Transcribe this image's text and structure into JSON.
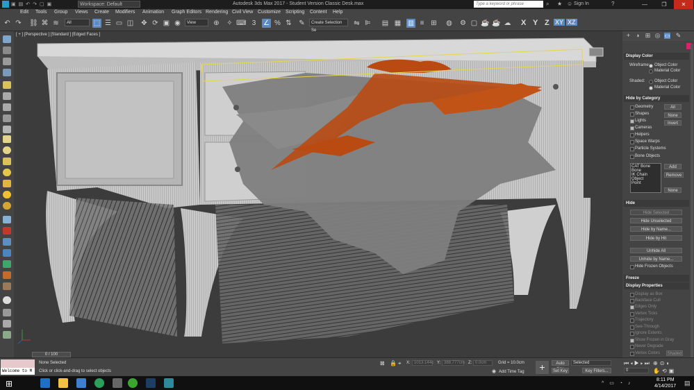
{
  "titlebar": {
    "workspace": "Workspace: Default",
    "title": "Autodesk 3ds Max 2017 - Student Version    Classic Desk.max",
    "search_placeholder": "Type a keyword or phrase",
    "sign_in": "Sign In"
  },
  "menu": [
    "Edit",
    "Tools",
    "Group",
    "Views",
    "Create",
    "Modifiers",
    "Animation",
    "Graph Editors",
    "Rendering",
    "Civil View",
    "Customize",
    "Scripting",
    "Content",
    "Help"
  ],
  "toolbar": {
    "filter_value": "All",
    "coord_value": "View",
    "selection_set_placeholder": "Create Selection Se",
    "axis_labels": [
      "X",
      "Y",
      "Z",
      "XY",
      "XZ"
    ]
  },
  "viewport": {
    "label": "[ + ] [Perspective ] [Standard ] [Edged Faces ]"
  },
  "panel": {
    "display_color": {
      "title": "Display Color",
      "wireframe_label": "Wireframe:",
      "shaded_label": "Shaded:",
      "object_color": "Object Color",
      "material_color": "Material Color"
    },
    "hide_by_category": {
      "title": "Hide by Category",
      "items": [
        {
          "label": "Geometry",
          "checked": false
        },
        {
          "label": "Shapes",
          "checked": false
        },
        {
          "label": "Lights",
          "checked": true
        },
        {
          "label": "Cameras",
          "checked": true
        },
        {
          "label": "Helpers",
          "checked": false
        },
        {
          "label": "Space Warps",
          "checked": false
        },
        {
          "label": "Particle Systems",
          "checked": false
        },
        {
          "label": "Bone Objects",
          "checked": false
        }
      ],
      "btn_all": "All",
      "btn_none": "None",
      "btn_invert": "Invert",
      "list": [
        "CAT Bone",
        "Bone",
        "IK Chain Object",
        "Point"
      ],
      "btn_add": "Add",
      "btn_remove": "Remove",
      "btn_none2": "None"
    },
    "hide": {
      "title": "Hide",
      "hide_selected": "Hide Selected",
      "hide_unselected": "Hide Unselected",
      "hide_by_name": "Hide by Name...",
      "hide_by_hit": "Hide by Hit",
      "unhide_all": "Unhide All",
      "unhide_by_name": "Unhide by Name...",
      "hide_frozen": "Hide Frozen Objects"
    },
    "freeze": {
      "title": "Freeze"
    },
    "display_properties": {
      "title": "Display Properties",
      "items": [
        {
          "label": "Display as Box",
          "checked": false
        },
        {
          "label": "Backface Cull",
          "checked": false
        },
        {
          "label": "Edges Only",
          "checked": true
        },
        {
          "label": "Vertex Ticks",
          "checked": false
        },
        {
          "label": "Trajectory",
          "checked": false
        },
        {
          "label": "See-Through",
          "checked": false
        },
        {
          "label": "Ignore Extents",
          "checked": false
        },
        {
          "label": "Show Frozen in Gray",
          "checked": true
        },
        {
          "label": "Never Degrade",
          "checked": false
        },
        {
          "label": "Vertex Colors",
          "checked": false
        }
      ],
      "shaded_btn": "Shaded"
    }
  },
  "timeline": {
    "slider": "0 / 100"
  },
  "status": {
    "maxscript": "Welcome to M",
    "selection": "None Selected",
    "prompt": "Click or click-and-drag to select objects",
    "x_label": "X:",
    "x_value": "1013.144c",
    "y_label": "Y:",
    "y_value": "388.777cm",
    "z_label": "Z:",
    "z_value": "0.0cm",
    "grid": "Grid = 10.0cm",
    "add_time_tag": "Add Time Tag",
    "auto_key": "Auto Key",
    "set_key": "Set Key",
    "selected_dropdown": "Selected",
    "key_filters": "Key Filters...",
    "frame": "0"
  },
  "taskbar": {
    "time": "8:11 PM",
    "date": "4/14/2017"
  },
  "colors": {
    "accent_blue": "#5a8ac6",
    "orange_object": "#b84a12",
    "selection_yellow": "#e8d54a"
  }
}
